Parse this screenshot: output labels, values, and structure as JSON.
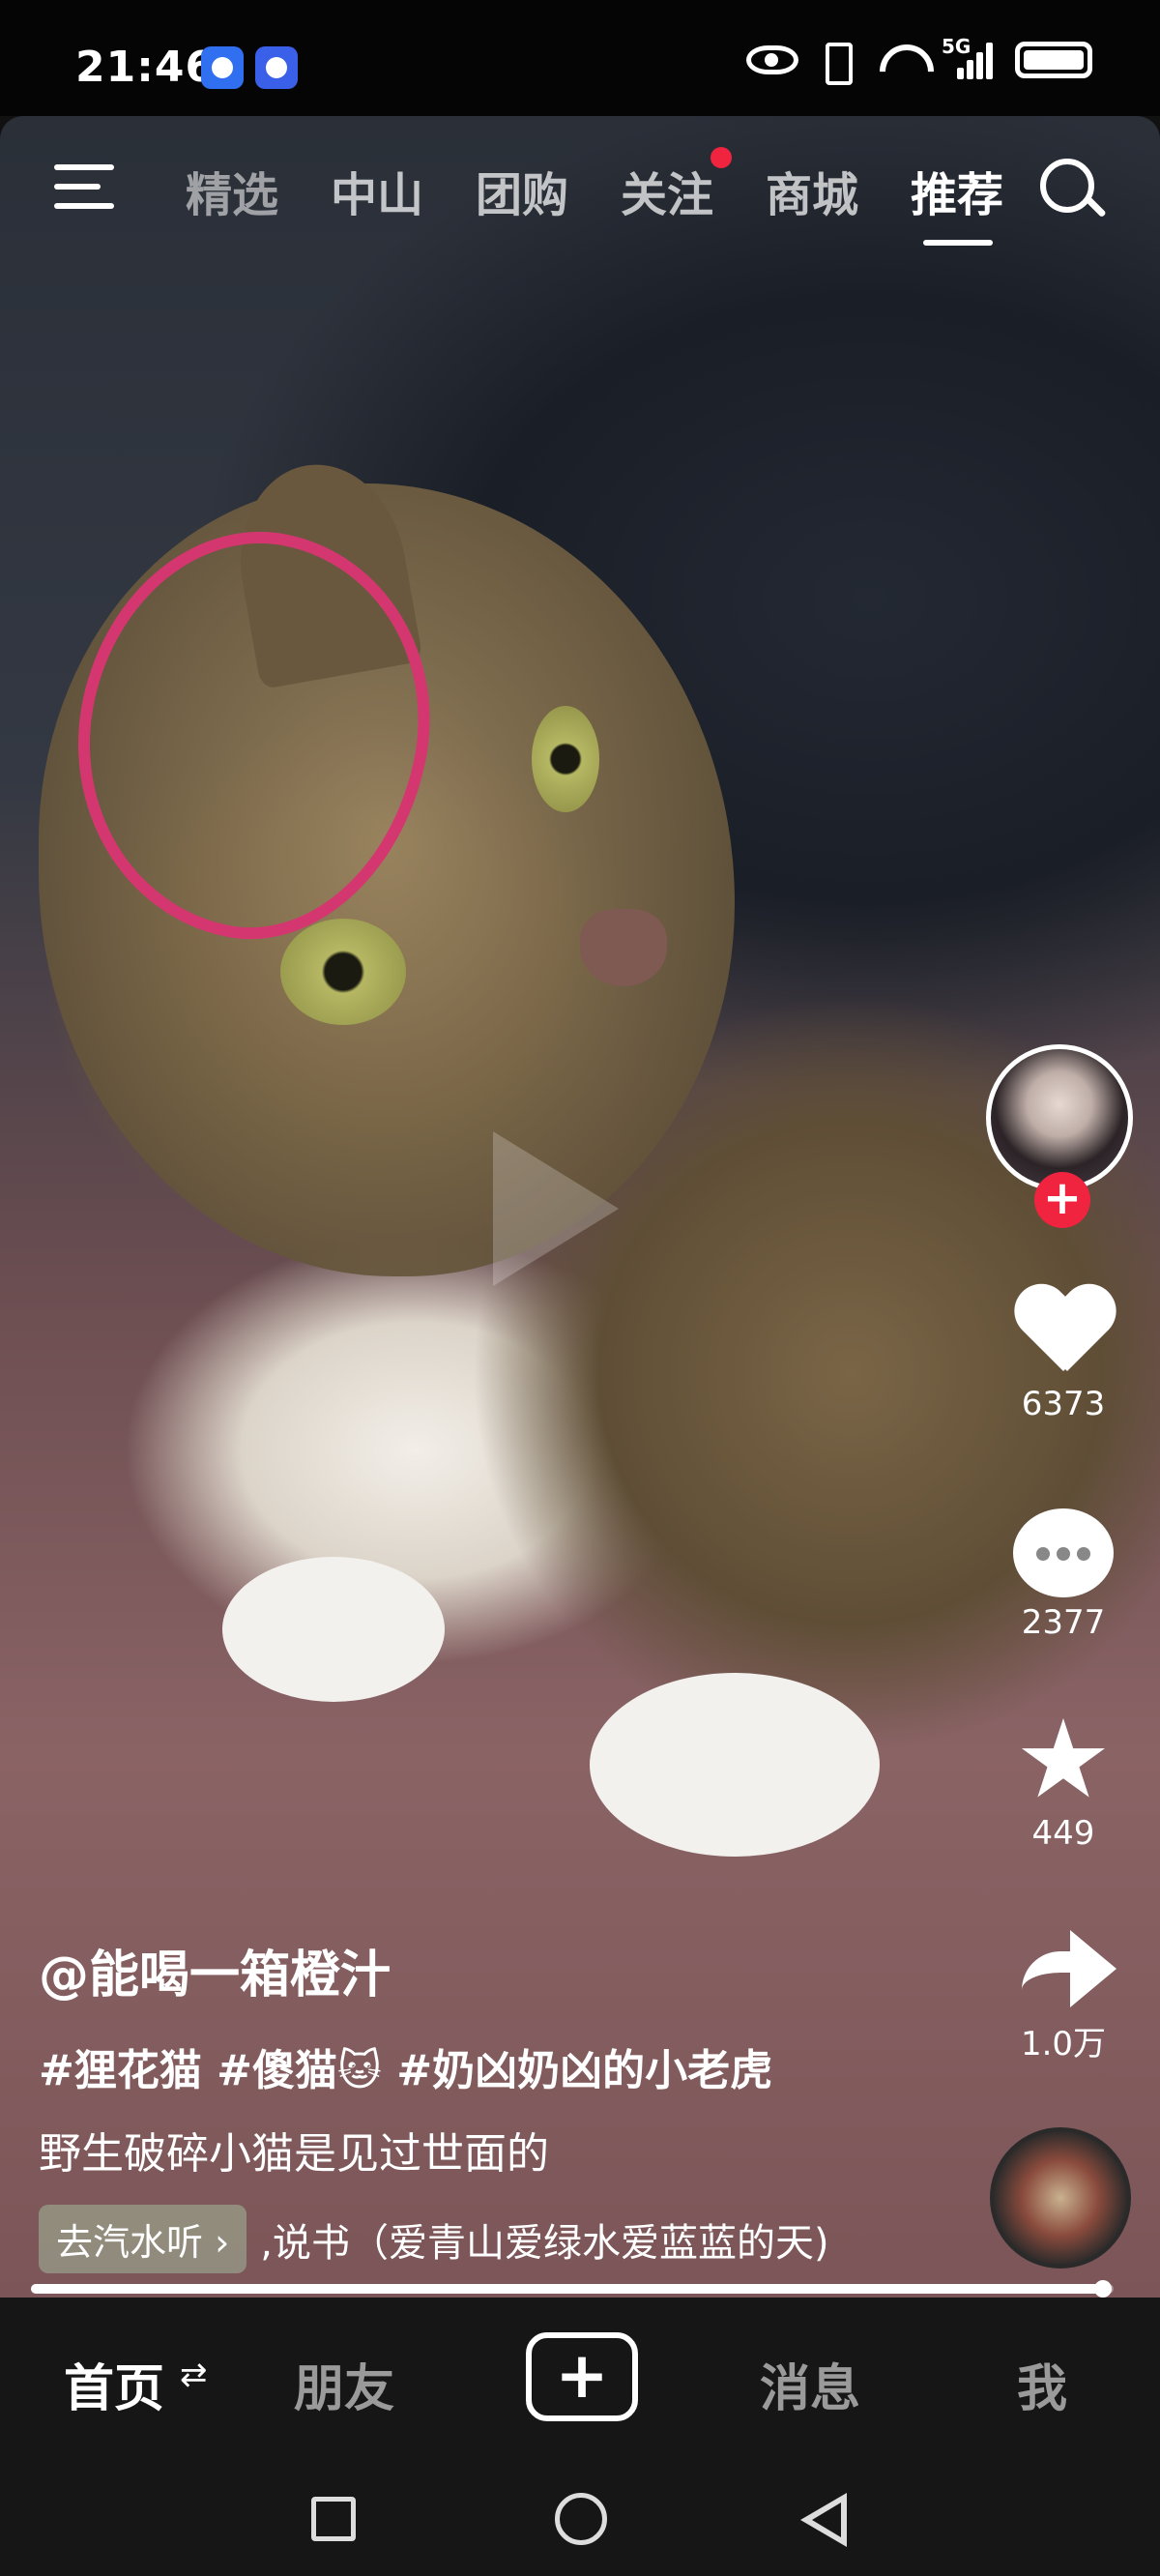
{
  "status_bar": {
    "time": "21:46",
    "network_label": "5G",
    "app_icons": [
      "browser-app-icon",
      "baidu-app-icon"
    ],
    "system_icons": [
      "eye-icon",
      "vibrate-icon",
      "wifi-icon",
      "signal-icon",
      "battery-icon"
    ]
  },
  "top_nav": {
    "tabs": [
      {
        "label": "精选",
        "active": false,
        "dot": false
      },
      {
        "label": "中山",
        "active": false,
        "dot": false
      },
      {
        "label": "团购",
        "active": false,
        "dot": false
      },
      {
        "label": "关注",
        "active": false,
        "dot": true
      },
      {
        "label": "商城",
        "active": false,
        "dot": false
      },
      {
        "label": "推荐",
        "active": true,
        "dot": false
      }
    ],
    "menu_icon": "menu-icon",
    "search_icon": "search-icon"
  },
  "actions": {
    "follow_symbol": "+",
    "likes": "6373",
    "comments": "2377",
    "favorites": "449",
    "shares": "1.0万"
  },
  "video": {
    "author": "@能喝一箱橙汁",
    "hashtags": "#狸花猫 #傻猫🐱 #奶凶奶凶的小老虎",
    "description": "野生破碎小猫是见过世面的",
    "listen_chip": "去汽水听 ›",
    "music_title": ",说书（爱青山爱绿水爱蓝蓝的天)",
    "progress": 0.99
  },
  "colors": {
    "accent_red": "#f0243f",
    "annotation_pink": "#d4376f"
  },
  "bottom_tabs": {
    "home": "首页",
    "home_swap": "⇄",
    "friends": "朋友",
    "create": "+",
    "messages": "消息",
    "me": "我"
  }
}
